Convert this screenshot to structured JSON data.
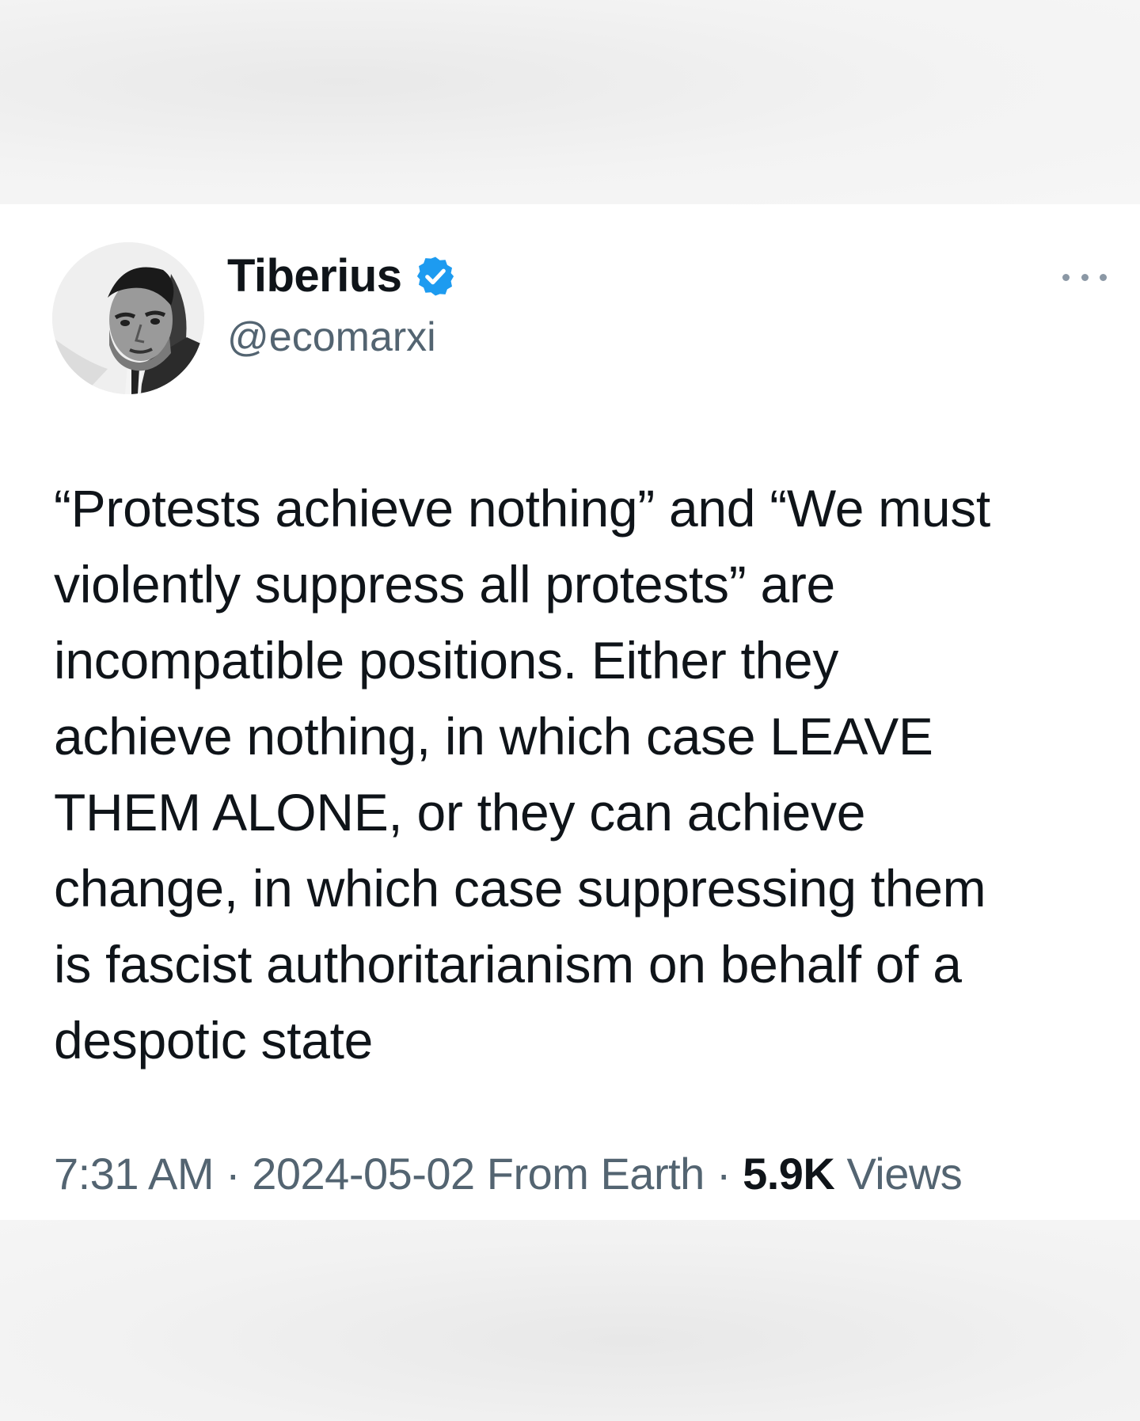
{
  "tweet": {
    "author": {
      "display_name": "Tiberius",
      "handle": "@ecomarxi",
      "verified": true,
      "avatar_icon": "avatar-portrait-icon",
      "verified_icon": "verified-badge-icon"
    },
    "more_icon": "more-options-icon",
    "text_lines": [
      "“Protests achieve nothing” and “We must",
      "violently suppress all protests” are",
      "incompatible positions. Either they",
      "achieve nothing, in which case LEAVE",
      "THEM ALONE, or they can achieve",
      "change, in which case suppressing them",
      "is fascist authoritarianism on behalf of a",
      "despotic state"
    ],
    "meta": {
      "time": "7:31 AM",
      "separator": " · ",
      "date": "2024-05-02",
      "location": "From Earth",
      "views_count": "5.9K",
      "views_label": "Views"
    }
  },
  "colors": {
    "primary_text": "#0f1419",
    "secondary_text": "#536471",
    "verified_blue": "#1d9bf0",
    "card_background": "#ffffff",
    "page_background": "#f1f1f1"
  }
}
